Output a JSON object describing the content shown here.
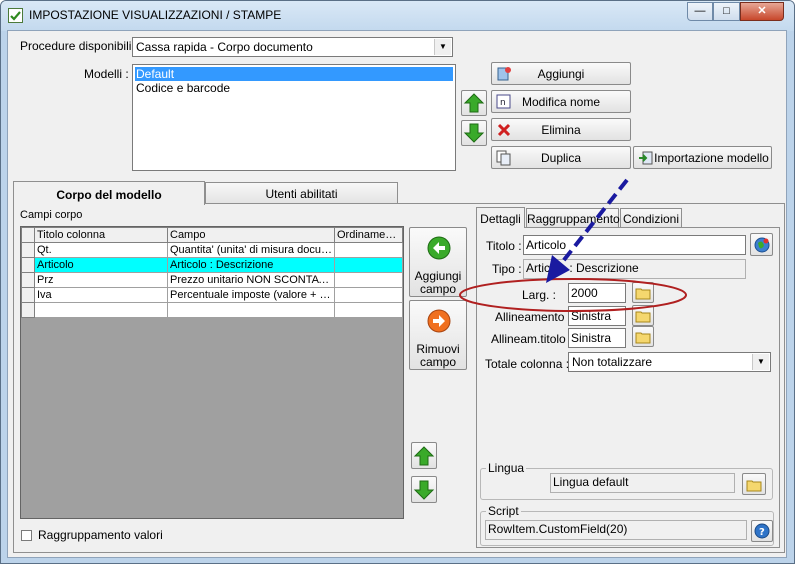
{
  "window": {
    "title": "IMPOSTAZIONE VISUALIZZAZIONI / STAMPE",
    "minimize_glyph": "—",
    "maximize_glyph": "□",
    "close_glyph": "✕"
  },
  "procedure": {
    "label": "Procedure disponibili :",
    "value": "Cassa rapida - Corpo documento"
  },
  "modelli": {
    "label": "Modelli :",
    "items": [
      "Default",
      "Codice e barcode"
    ],
    "selected_index": 0
  },
  "model_buttons": {
    "add": "Aggiungi",
    "rename": "Modifica nome",
    "delete": "Elimina",
    "duplicate": "Duplica",
    "import": "Importazione modello"
  },
  "main_tabs": [
    "Corpo del modello",
    "Utenti abilitati"
  ],
  "campi_corpo": {
    "label": "Campi corpo",
    "columns": [
      "Titolo colonna",
      "Campo",
      "Ordinamento"
    ],
    "rows": [
      {
        "titolo": "Qt.",
        "campo": "Quantita' (unita' di misura docum...",
        "ordinamento": ""
      },
      {
        "titolo": "Articolo",
        "campo": "Articolo : Descrizione",
        "ordinamento": ""
      },
      {
        "titolo": "Prz",
        "campo": "Prezzo unitario NON SCONTAT...",
        "ordinamento": ""
      },
      {
        "titolo": "Iva",
        "campo": "Percentuale imposte (valore + si...",
        "ordinamento": ""
      },
      {
        "titolo": "",
        "campo": "",
        "ordinamento": ""
      }
    ],
    "selected_row": 1
  },
  "field_buttons": {
    "add_line1": "Aggiungi",
    "add_line2": "campo",
    "remove_line1": "Rimuovi",
    "remove_line2": "campo"
  },
  "raggruppamento": {
    "label": "Raggruppamento valori",
    "checked": false
  },
  "detail_tabs": [
    "Dettagli",
    "Raggruppamento",
    "Condizioni"
  ],
  "details": {
    "titolo_label": "Titolo :",
    "titolo_value": "Articolo",
    "tipo_label": "Tipo :",
    "tipo_value": "Articolo : Descrizione",
    "larg_label": "Larg. :",
    "larg_value": "2000",
    "allineamento_label": "Allineamento :",
    "allineamento_value": "Sinistra",
    "allineam_titolo_label": "Allineam.titolo :",
    "allineam_titolo_value": "Sinistra",
    "totale_label": "Totale colonna :",
    "totale_value": "Non totalizzare"
  },
  "lingua": {
    "legend": "Lingua",
    "value": "Lingua default"
  },
  "script": {
    "legend": "Script",
    "value": "RowItem.CustomField(20)"
  },
  "colors": {
    "selection": "#00ffff",
    "listbox_selection": "#3399ff",
    "annotation_arrow": "#1a1aa0",
    "annotation_ellipse": "#b02020",
    "green_arrow": "#3aaa2a",
    "orange_arrow": "#f07020"
  }
}
